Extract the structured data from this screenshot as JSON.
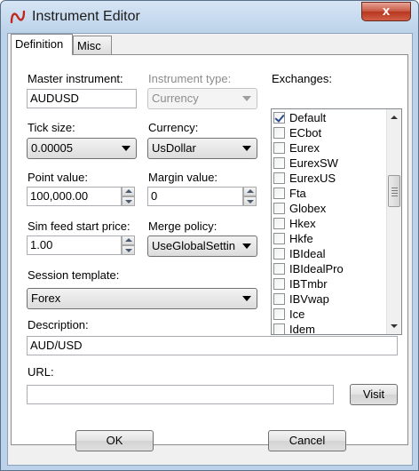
{
  "window": {
    "title": "Instrument Editor",
    "close_glyph": "x"
  },
  "tabs": [
    {
      "label": "Definition"
    },
    {
      "label": "Misc"
    }
  ],
  "fields": {
    "master_instrument": {
      "label": "Master instrument:",
      "value": "AUDUSD"
    },
    "instrument_type": {
      "label": "Instrument type:",
      "value": "Currency"
    },
    "tick_size": {
      "label": "Tick size:",
      "value": "0.00005"
    },
    "currency": {
      "label": "Currency:",
      "value": "UsDollar"
    },
    "point_value": {
      "label": "Point value:",
      "value": "100,000.00"
    },
    "margin_value": {
      "label": "Margin value:",
      "value": "0"
    },
    "sim_feed_start_price": {
      "label": "Sim feed start price:",
      "value": "1.00"
    },
    "merge_policy": {
      "label": "Merge policy:",
      "value": "UseGlobalSettin"
    },
    "session_template": {
      "label": "Session template:",
      "value": "Forex"
    },
    "description": {
      "label": "Description:",
      "value": "AUD/USD"
    },
    "url": {
      "label": "URL:",
      "value": ""
    }
  },
  "exchanges": {
    "label": "Exchanges:",
    "items": [
      {
        "name": "Default",
        "checked": true
      },
      {
        "name": "ECbot",
        "checked": false
      },
      {
        "name": "Eurex",
        "checked": false
      },
      {
        "name": "EurexSW",
        "checked": false
      },
      {
        "name": "EurexUS",
        "checked": false
      },
      {
        "name": "Fta",
        "checked": false
      },
      {
        "name": "Globex",
        "checked": false
      },
      {
        "name": "Hkex",
        "checked": false
      },
      {
        "name": "Hkfe",
        "checked": false
      },
      {
        "name": "IBIdeal",
        "checked": false
      },
      {
        "name": "IBIdealPro",
        "checked": false
      },
      {
        "name": "IBTmbr",
        "checked": false
      },
      {
        "name": "IBVwap",
        "checked": false
      },
      {
        "name": "Ice",
        "checked": false
      },
      {
        "name": "Idem",
        "checked": false
      }
    ]
  },
  "buttons": {
    "visit": "Visit",
    "ok": "OK",
    "cancel": "Cancel"
  },
  "icons": {
    "app_icon": "ninjatrader-logo-icon",
    "close": "close-icon",
    "spin_up": "spin-up-icon",
    "spin_down": "spin-down-icon",
    "dropdown": "chevron-down-icon"
  },
  "colors": {
    "window_frame": "#bcd2ea",
    "close_button": "#c75a45",
    "checkmark": "#2a4a8a"
  }
}
